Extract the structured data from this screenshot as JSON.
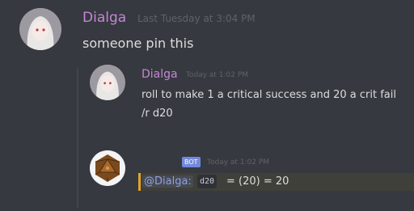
{
  "messages": [
    {
      "author": "Dialga",
      "timestamp": "Last Tuesday at 3:04 PM",
      "text": "someone pin this"
    },
    {
      "author": "Dialga",
      "timestamp": "Today at 1:02 PM",
      "lines": [
        "roll to make 1 a critical success and 20 a crit fail",
        "/r d20"
      ]
    },
    {
      "badge": "BOT",
      "timestamp": "Today at 1:02 PM",
      "mention": "@Dialga:",
      "code": "d20",
      "result": "= (20) = 20"
    }
  ],
  "colors": {
    "background": "#36393f",
    "username": "#c586d6",
    "bot_badge": "#7289da",
    "mention_bar": "#e2a32a"
  }
}
